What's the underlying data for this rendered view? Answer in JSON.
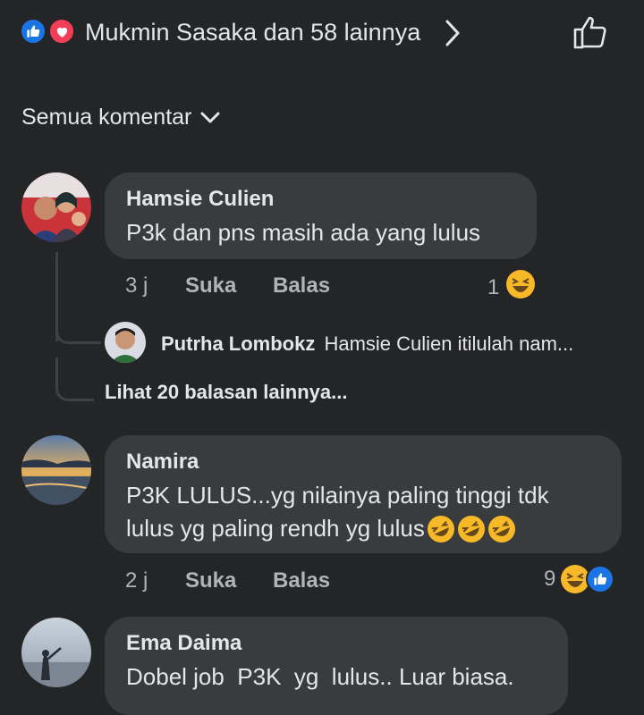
{
  "header": {
    "reactions_text": "Mukmin Sasaka dan 58 lainnya",
    "like_color": "#1b74e4",
    "love_color": "#f33e58"
  },
  "filter": {
    "label": "Semua komentar"
  },
  "comments": [
    {
      "author": "Hamsie Culien",
      "text": "P3k dan pns masih ada yang lulus",
      "time": "3 j",
      "like_label": "Suka",
      "reply_label": "Balas",
      "reaction_count": "1",
      "reply": {
        "author": "Putrha Lombokz",
        "text": "Hamsie Culien itilulah nam..."
      },
      "more_replies": "Lihat 20 balasan lainnya..."
    },
    {
      "author": "Namira",
      "text_lines": [
        "P3K LULUS...yg nilainya paling tinggi tdk",
        "lulus yg paling rendh yg lulus"
      ],
      "time": "2 j",
      "like_label": "Suka",
      "reply_label": "Balas",
      "reaction_count": "9"
    },
    {
      "author": "Ema Daima",
      "text": "Dobel job  P3K  yg  lulus.. Luar biasa."
    }
  ]
}
